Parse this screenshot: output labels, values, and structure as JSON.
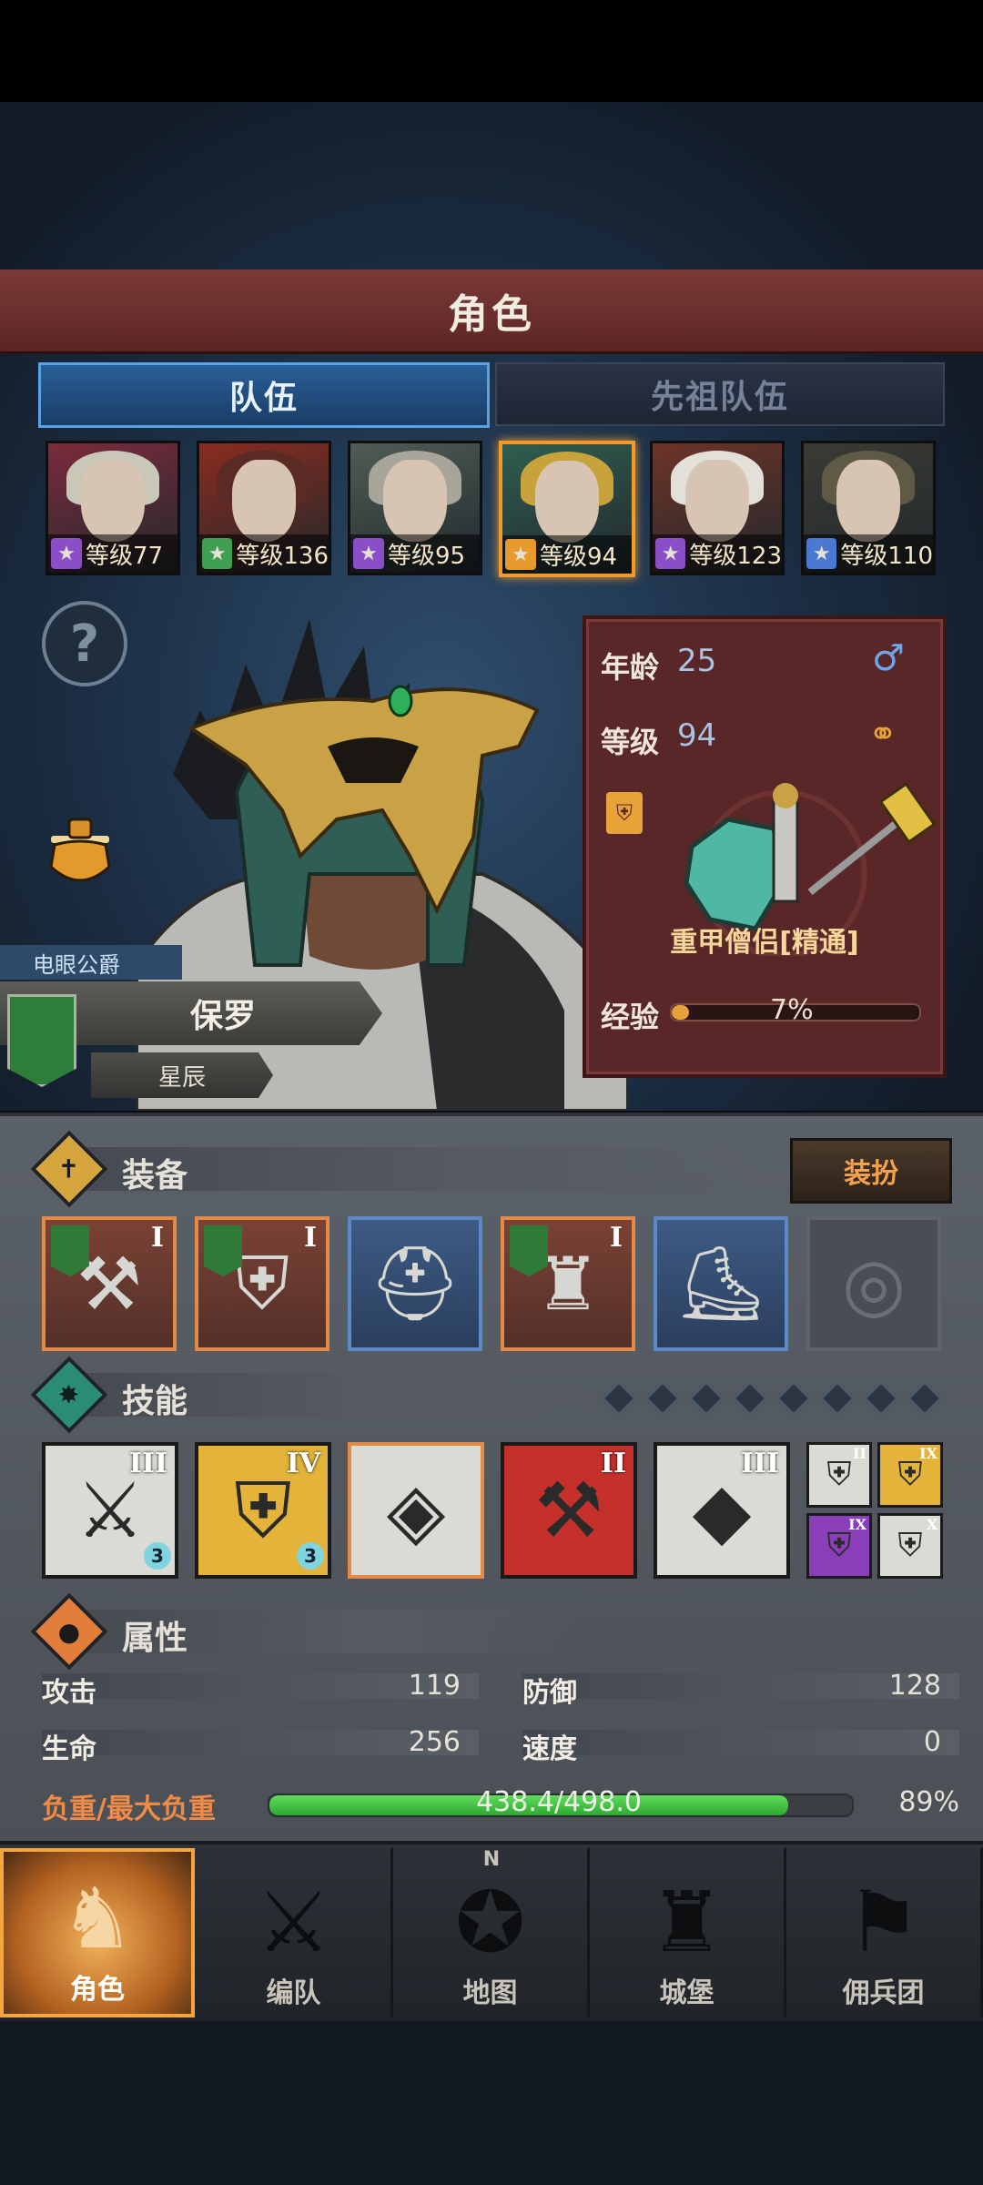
{
  "screen": {
    "title": "角色"
  },
  "tabs": {
    "team": "队伍",
    "ancestor": "先祖队伍"
  },
  "party": [
    {
      "level": "等级77",
      "class_color": "#8a4ec7",
      "hair": "#c9c7b7",
      "accent": "#7b2b3c"
    },
    {
      "level": "等级136",
      "class_color": "#3e9e52",
      "hair": "#5a2a24",
      "accent": "#8a2c1f"
    },
    {
      "level": "等级95",
      "class_color": "#8a4ec7",
      "hair": "#a7a49a",
      "accent": "#4f5d55"
    },
    {
      "level": "等级94",
      "class_color": "#e79a2b",
      "hair": "#c8a23b",
      "accent": "#2f5e4f"
    },
    {
      "level": "等级123",
      "class_color": "#8a4ec7",
      "hair": "#e2e0d8",
      "accent": "#6d3427"
    },
    {
      "level": "等级110",
      "class_color": "#4a78d2",
      "hair": "#5e5a46",
      "accent": "#3a3b33"
    }
  ],
  "hero": {
    "title": "电眼公爵",
    "name": "保罗",
    "rank": "星辰"
  },
  "info": {
    "age_label": "年龄",
    "age": "25",
    "level_label": "等级",
    "level": "94",
    "class_name": "重甲僧侣[精通]",
    "exp_label": "经验",
    "exp_percent": "7%",
    "exp_fraction": 0.07
  },
  "equipment": {
    "title": "装备",
    "dress_button": "装扮",
    "slots": [
      {
        "name": "mace",
        "rarity": "orange",
        "roman": "I",
        "banner": true
      },
      {
        "name": "shield",
        "rarity": "orange",
        "roman": "I",
        "banner": true
      },
      {
        "name": "helmet",
        "rarity": "blue",
        "roman": "",
        "banner": false
      },
      {
        "name": "armor",
        "rarity": "orange",
        "roman": "I",
        "banner": true
      },
      {
        "name": "boots",
        "rarity": "blue",
        "roman": "",
        "banner": false
      },
      {
        "name": "ring",
        "rarity": "empty",
        "roman": "",
        "banner": false
      }
    ]
  },
  "skills": {
    "title": "技能",
    "points_total": 8,
    "main": [
      {
        "roman": "III",
        "gem": "3",
        "bg": "#d9dbd4"
      },
      {
        "roman": "IV",
        "gem": "3",
        "bg": "#e4b43a"
      },
      {
        "roman": "",
        "gem": "",
        "bg": "#d9dbd4"
      },
      {
        "roman": "II",
        "gem": "",
        "bg": "#c6302b"
      },
      {
        "roman": "III",
        "gem": "",
        "bg": "#d9dbd4"
      }
    ],
    "mini": [
      {
        "roman": "II",
        "bg": "#d9dbd4"
      },
      {
        "roman": "IX",
        "bg": "#e4b43a"
      },
      {
        "roman": "IX",
        "bg": "#8a3fb8"
      },
      {
        "roman": "X",
        "bg": "#d9dbd4"
      }
    ]
  },
  "attributes": {
    "title": "属性",
    "attack_label": "攻击",
    "attack": "119",
    "defense_label": "防御",
    "defense": "128",
    "hp_label": "生命",
    "hp": "256",
    "speed_label": "速度",
    "speed": "0",
    "load_label": "负重/最大负重",
    "load_value": "438.4/498.0",
    "load_percent": "89%",
    "load_fraction": 0.89
  },
  "nav": [
    {
      "label": "角色",
      "glyph": "♞"
    },
    {
      "label": "编队",
      "glyph": "⚔"
    },
    {
      "label": "地图",
      "glyph": "✪"
    },
    {
      "label": "城堡",
      "glyph": "♜"
    },
    {
      "label": "佣兵团",
      "glyph": "⚑"
    }
  ],
  "nav_compass_letter": "N"
}
